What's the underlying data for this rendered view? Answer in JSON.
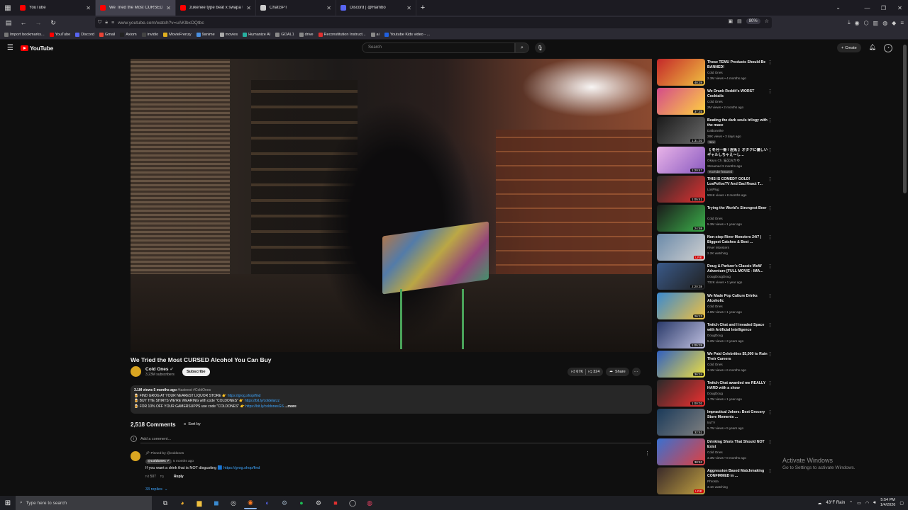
{
  "browser": {
    "tabs": [
      {
        "label": "YouTube",
        "color": "#ff0000",
        "active": false
      },
      {
        "label": "We Tried the Most CURSED Alcoh",
        "color": "#ff0000",
        "active": true
      },
      {
        "label": "zukenee type beat x swapa typ",
        "color": "#ff0000",
        "active": false
      },
      {
        "label": "ChatGPT",
        "color": "#cccccc",
        "active": false
      },
      {
        "label": "Discord | @Rambo",
        "color": "#5865f2",
        "active": false
      }
    ],
    "url": "www.youtube.com/watch?v=uAKlbxOQtbc",
    "zoom": "80%",
    "bookmarks": [
      {
        "label": "Import bookmarks...",
        "color": "#777777"
      },
      {
        "label": "YouTube",
        "color": "#ff0000"
      },
      {
        "label": "Discord",
        "color": "#5865f2"
      },
      {
        "label": "Gmail",
        "color": "#ea4335"
      },
      {
        "label": "Axiom",
        "color": "#222222"
      },
      {
        "label": "invidio",
        "color": "#444444"
      },
      {
        "label": "MovieFrenzy",
        "color": "#e0b020"
      },
      {
        "label": "9anime",
        "color": "#4a90e2"
      },
      {
        "label": "movies",
        "color": "#aaaaaa"
      },
      {
        "label": "Humanize AI",
        "color": "#27b0a0"
      },
      {
        "label": "GOAL1",
        "color": "#888888"
      },
      {
        "label": "drive",
        "color": "#888888"
      },
      {
        "label": "Reconstitution Instruct...",
        "color": "#e03030"
      },
      {
        "label": "ai",
        "color": "#888888"
      },
      {
        "label": "Youtube Kids video - ...",
        "color": "#2060e0"
      }
    ]
  },
  "youtube": {
    "logo_text": "YouTube",
    "search_placeholder": "Search",
    "create_label": "Create"
  },
  "video": {
    "title": "We Tried the Most CURSED Alcohol You Can Buy",
    "channel": "Cold Ones",
    "subscribers": "3.23M subscribers",
    "subscribe_label": "Subscribe",
    "likes": "67K",
    "dislikes": "324",
    "share_label": "Share",
    "description": {
      "meta": "3.1M views  5 months ago",
      "tags": "#tasteest #ColdOnes",
      "line1_text": "🍺 FIND GROG AT YOUR NEAREST LIQUOR STORE 👉 ",
      "line1_link": "https://grog.shop/find",
      "line2_text": "🍺 BUY THE SHIRTS WE'RE WEARING with code \"COLDONES\" 👉 ",
      "line2_link": "https://bit.ly/coldelarzz",
      "line3_text": "🍺 FOR 10% OFF YOUR GAMERSUPPS use code \"COLDONES\" 👉 ",
      "line3_link": "https://bit.ly/coldonesGS",
      "more": "...more"
    }
  },
  "comments": {
    "count": "2,518 Comments",
    "sort_label": "Sort by",
    "add_placeholder": "Add a comment...",
    "pinned_label": "Pinned by @coldones",
    "author": "@coldones",
    "time": "5 months ago",
    "text": "If you want a drink that is NOT disgusting ",
    "text_link": "https://grog.shop/find",
    "likes": "507",
    "reply_label": "Reply",
    "replies": "33 replies"
  },
  "recommendations": [
    {
      "title": "These TEMU Products Should Be BANNED!",
      "channel": "Cold Ones",
      "meta": "2.3M views • 4 months ago",
      "duration": "48:39",
      "badge": "",
      "c1": "#c4282a",
      "c2": "#f0c040"
    },
    {
      "title": "We Drank Reddit's WORST Cocktails",
      "channel": "Cold Ones",
      "meta": "2M views • 2 months ago",
      "duration": "37:25",
      "badge": "",
      "c1": "#d44b8a",
      "c2": "#ffd23f"
    },
    {
      "title": "Beating the dark souls trilogy with the mace",
      "channel": "Dalbonnike",
      "meta": "28K views • 3 days ago",
      "duration": "1:31:02",
      "badge": "New",
      "c1": "#1a1a1a",
      "c2": "#6a6a6a"
    },
    {
      "title": "【 冬月一番 / 淫兎 】オタクに優しいギャルしちゃえ～し…",
      "channel": "Okayu Ch. 猫又おかゆ",
      "meta": "Streamed 9 months ago",
      "duration": "1:20:47",
      "badge": "YouTube featured",
      "c1": "#e9b4e8",
      "c2": "#8a5ac0"
    },
    {
      "title": "THIS IS COMEDY GOLD! LosPollosTV And Dad React T...",
      "channel": "LosPlug",
      "meta": "504K views • 8 months ago",
      "duration": "1:05:41",
      "badge": "",
      "c1": "#2a2a2a",
      "c2": "#e03030"
    },
    {
      "title": "Trying the World's Strongest Beer",
      "channel": "Cold Ones",
      "meta": "5.3M views • 1 year ago",
      "duration": "24:59",
      "badge": "",
      "c1": "#1a1a1a",
      "c2": "#3bb04a"
    },
    {
      "title": "Non-stop River Monsters 24/7 | Biggest Catches & Best ...",
      "channel": "River Monsters",
      "meta": "2.2K watching",
      "duration": "LIVE",
      "badge": "",
      "c1": "#6a8aaa",
      "c2": "#d0d0d0"
    },
    {
      "title": "Doug & Parkzer's Classic WoW Adventure [FULL MOVIE - IMA...",
      "channel": "DougDougDoug",
      "meta": "732K views • 1 year ago",
      "duration": "2:20:38",
      "badge": "",
      "c1": "#3a5a8a",
      "c2": "#202020"
    },
    {
      "title": "We Made Pop Culture Drinks Alcoholic",
      "channel": "Cold Ones",
      "meta": "4.8M views • 1 year ago",
      "duration": "26:13",
      "badge": "",
      "c1": "#3a8ad0",
      "c2": "#f0c040"
    },
    {
      "title": "Twitch Chat and I invaded Space with Artificial Intelligence",
      "channel": "DougDoug",
      "meta": "5.2M views • 3 years ago",
      "duration": "1:05:28",
      "badge": "",
      "c1": "#2a3a6a",
      "c2": "#c0c0e0"
    },
    {
      "title": "We Paid Celebrities $5,000 to Ruin Their Careers",
      "channel": "Cold Ones",
      "meta": "3.1M views • 6 months ago",
      "duration": "36:24",
      "badge": "",
      "c1": "#3060c0",
      "c2": "#f0e040"
    },
    {
      "title": "Twitch Chat awarded me REALLY HARD with a show",
      "channel": "DougDoug",
      "meta": "1.7M views • 1 year ago",
      "duration": "1:00:03",
      "badge": "",
      "c1": "#2a2a2a",
      "c2": "#f03030"
    },
    {
      "title": "Impractical Jokers: Best Grocery Store Moments ...",
      "channel": "truTV",
      "meta": "5.7M views • 5 years ago",
      "duration": "32:51",
      "badge": "",
      "c1": "#1a3a5a",
      "c2": "#808080"
    },
    {
      "title": "Drinking Shots That Should NOT Exist",
      "channel": "Cold Ones",
      "meta": "3.3M views • 8 months ago",
      "duration": "38:52",
      "badge": "",
      "c1": "#3a70d0",
      "c2": "#e04040"
    },
    {
      "title": "Aggression Based Matchmaking CONFIRMED in ...",
      "channel": "Phrosta",
      "meta": "3.1K watching",
      "duration": "LIVE",
      "badge": "",
      "c1": "#3a2a2a",
      "c2": "#c0a040"
    }
  ],
  "windows_watermark": {
    "line1": "Activate Windows",
    "line2": "Go to Settings to activate Windows."
  },
  "taskbar": {
    "search_placeholder": "Type here to search",
    "weather": "43°F  Rain",
    "time": "5:54 PM",
    "date": "1/4/2026"
  }
}
